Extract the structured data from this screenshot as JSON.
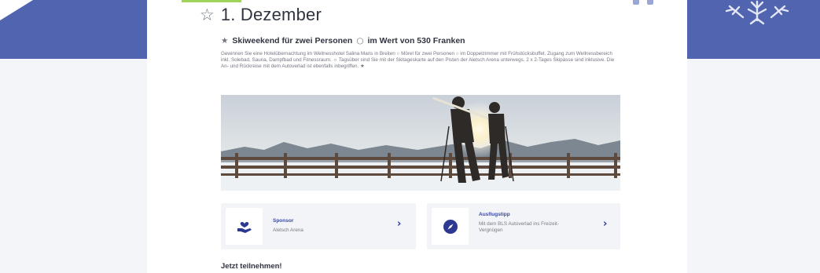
{
  "header": {
    "day_star": "☆",
    "day_title": "1. Dezember"
  },
  "prize": {
    "star_prefix": "★",
    "title_left": "Skiweekend für zwei Personen",
    "separator": "○",
    "title_right": "im Wert von 530 Franken",
    "description": "Gewinnen Sie eine Hotelübernachtung im Wellnesshotel Salina Maris in Breiten ○ Mörel für zwei Personen ○ im Doppelzimmer mit Frühstücksbuffet. Zugang zum Wellnessbereich inkl. Solebad, Sauna, Dampfbad und Fitnessraum. ☼ Tagsüber sind Sie mit der Skitageskarte auf den Pisten der Aletsch Arena unterwegs. 2 x 2-Tages Skipässe sind inklusive. Die An- und Rückreise mit dem Autoverlad ist ebenfalls inbegriffen. ★"
  },
  "tiles": {
    "sponsor": {
      "title": "Sponsor",
      "subtitle": "Aletsch Arena",
      "chevron": "›",
      "icon": "hand-heart-icon"
    },
    "ausflug": {
      "title": "Ausflugstipp",
      "subtitle": "Mit dem BLS Autoverlad ins Freizeit-Vergnügen",
      "chevron": "›",
      "icon": "compass-icon"
    }
  },
  "cta": {
    "heading": "Jetzt teilnehmen!"
  },
  "colors": {
    "brand_blue": "#5164b0",
    "accent_green": "#9fd45a",
    "link_blue": "#2d3990",
    "tile_bg": "#f2f4f8",
    "page_bg": "#f4f5f9"
  }
}
